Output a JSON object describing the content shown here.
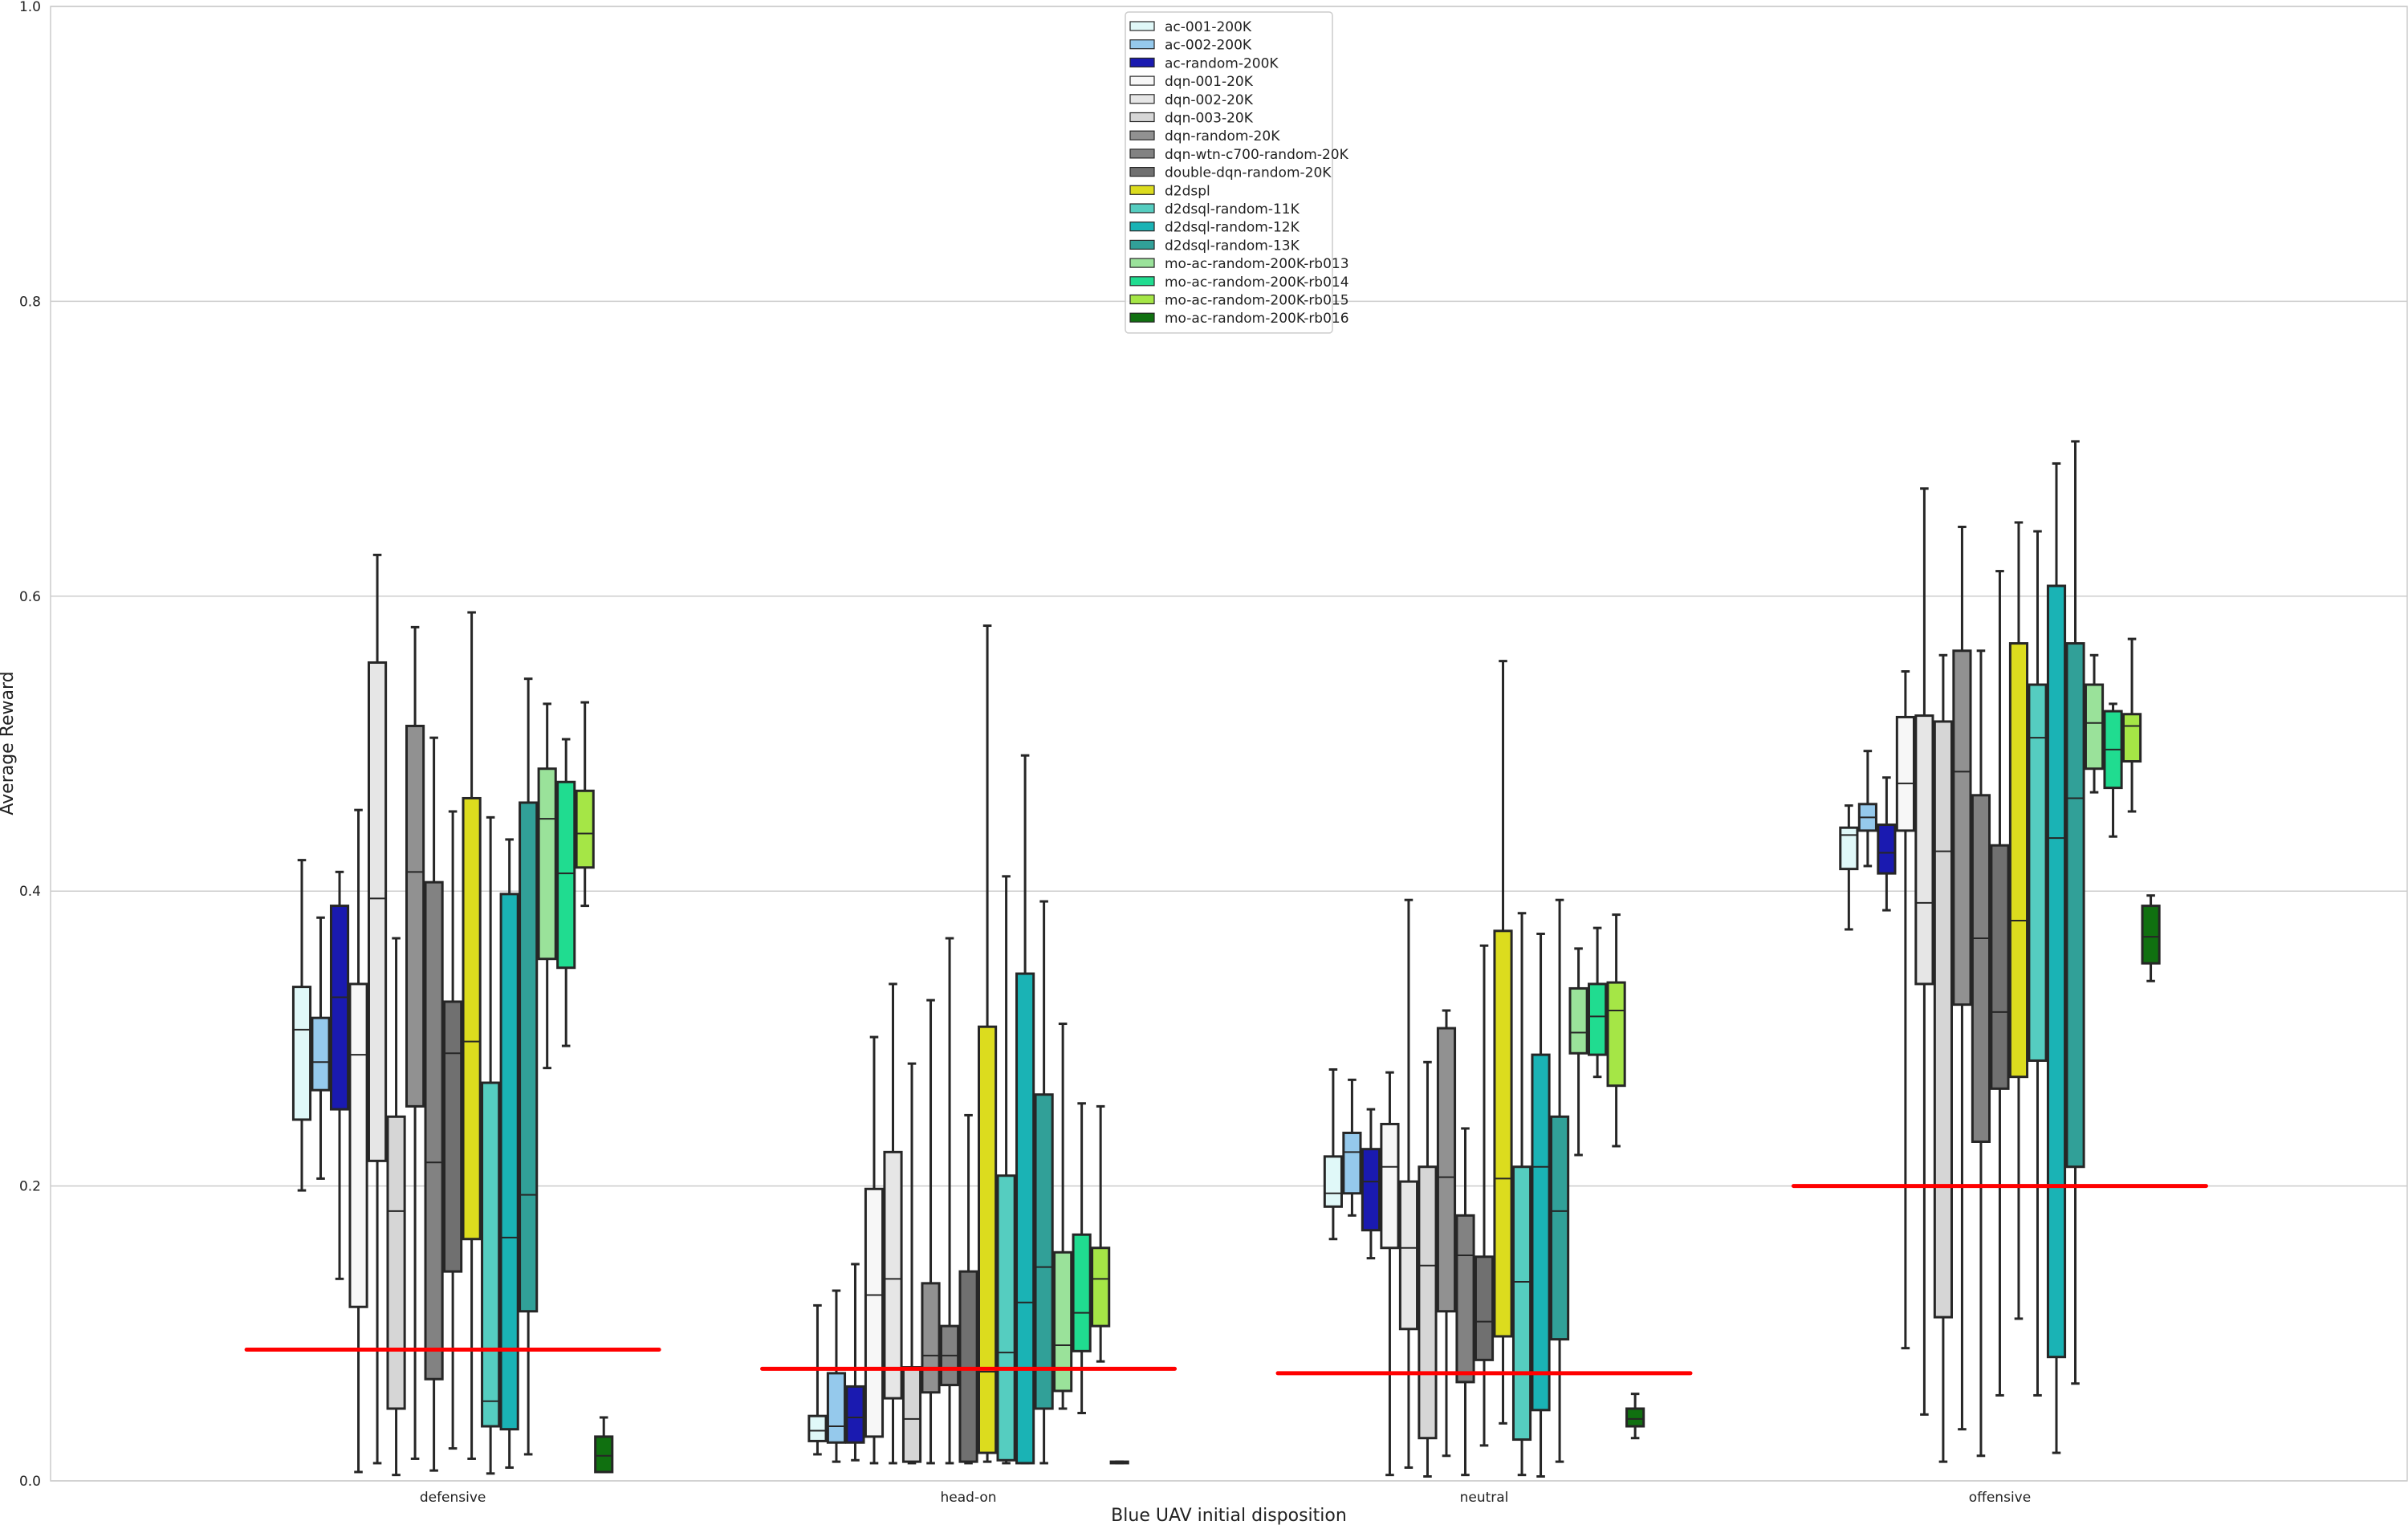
{
  "chart_data": {
    "type": "box",
    "title": "",
    "xlabel": "Blue UAV initial disposition",
    "ylabel": "Average Reward",
    "ylim": [
      0.0,
      1.0
    ],
    "yticks": [
      "0.0",
      "0.2",
      "0.4",
      "0.6",
      "0.8",
      "1.0"
    ],
    "categories": [
      "defensive",
      "head-on",
      "neutral",
      "offensive"
    ],
    "grid": "horizontal",
    "legend_position": "top-center",
    "box_stat_order": [
      "whisker_low",
      "q1",
      "median",
      "q3",
      "whisker_high"
    ],
    "reference_line": {
      "color": "#ff0000",
      "values": [
        0.089,
        0.076,
        0.073,
        0.2
      ]
    },
    "series": [
      {
        "name": "ac-001-200K",
        "color": "#e0f8f8",
        "boxes": [
          [
            0.197,
            0.245,
            0.306,
            0.335,
            0.421
          ],
          [
            0.018,
            0.027,
            0.034,
            0.044,
            0.119
          ],
          [
            0.164,
            0.186,
            0.195,
            0.22,
            0.279
          ],
          [
            0.374,
            0.415,
            0.438,
            0.443,
            0.458
          ]
        ]
      },
      {
        "name": "ac-002-200K",
        "color": "#95c9ec",
        "boxes": [
          [
            0.205,
            0.265,
            0.284,
            0.314,
            0.382
          ],
          [
            0.013,
            0.026,
            0.037,
            0.073,
            0.129
          ],
          [
            0.18,
            0.195,
            0.223,
            0.236,
            0.272
          ],
          [
            0.417,
            0.441,
            0.45,
            0.459,
            0.495
          ]
        ]
      },
      {
        "name": "ac-random-200K",
        "color": "#1a1ab0",
        "boxes": [
          [
            0.137,
            0.252,
            0.328,
            0.39,
            0.413
          ],
          [
            0.014,
            0.026,
            0.043,
            0.064,
            0.147
          ],
          [
            0.151,
            0.17,
            0.203,
            0.225,
            0.252
          ],
          [
            0.387,
            0.412,
            0.426,
            0.445,
            0.477
          ]
        ]
      },
      {
        "name": "dqn-001-20K",
        "color": "#f7f7f7",
        "boxes": [
          [
            0.006,
            0.118,
            0.289,
            0.337,
            0.455
          ],
          [
            0.012,
            0.03,
            0.126,
            0.198,
            0.301
          ],
          [
            0.004,
            0.158,
            0.213,
            0.242,
            0.277
          ],
          [
            0.09,
            0.441,
            0.473,
            0.518,
            0.549
          ]
        ]
      },
      {
        "name": "dqn-002-20K",
        "color": "#e6e6e6",
        "boxes": [
          [
            0.012,
            0.217,
            0.395,
            0.555,
            0.628
          ],
          [
            0.012,
            0.056,
            0.137,
            0.223,
            0.337
          ],
          [
            0.009,
            0.103,
            0.158,
            0.203,
            0.394
          ],
          [
            0.045,
            0.337,
            0.392,
            0.519,
            0.673
          ]
        ]
      },
      {
        "name": "dqn-003-20K",
        "color": "#d6d6d6",
        "boxes": [
          [
            0.004,
            0.049,
            0.183,
            0.247,
            0.368
          ],
          [
            0.012,
            0.013,
            0.042,
            0.077,
            0.283
          ],
          [
            0.003,
            0.029,
            0.146,
            0.213,
            0.284
          ],
          [
            0.013,
            0.111,
            0.427,
            0.515,
            0.56
          ]
        ]
      },
      {
        "name": "dqn-random-20K",
        "color": "#919191",
        "boxes": [
          [
            0.015,
            0.254,
            0.413,
            0.512,
            0.579
          ],
          [
            0.012,
            0.06,
            0.085,
            0.134,
            0.326
          ],
          [
            0.017,
            0.115,
            0.206,
            0.307,
            0.319
          ],
          [
            0.035,
            0.323,
            0.481,
            0.563,
            0.647
          ]
        ]
      },
      {
        "name": "dqn-wtn-c700-random-20K",
        "color": "#828282",
        "boxes": [
          [
            0.007,
            0.069,
            0.216,
            0.406,
            0.504
          ],
          [
            0.012,
            0.065,
            0.085,
            0.105,
            0.368
          ],
          [
            0.004,
            0.067,
            0.153,
            0.18,
            0.239
          ],
          [
            0.017,
            0.23,
            0.368,
            0.465,
            0.563
          ]
        ]
      },
      {
        "name": "double-dqn-random-20K",
        "color": "#707070",
        "boxes": [
          [
            0.022,
            0.142,
            0.29,
            0.325,
            0.454
          ],
          [
            0.012,
            0.013,
            0.013,
            0.142,
            0.248
          ],
          [
            0.024,
            0.082,
            0.108,
            0.152,
            0.363
          ],
          [
            0.058,
            0.266,
            0.318,
            0.431,
            0.617
          ]
        ]
      },
      {
        "name": "d2dspl",
        "color": "#dcdc1e",
        "boxes": [
          [
            0.015,
            0.164,
            0.298,
            0.463,
            0.589
          ],
          [
            0.013,
            0.019,
            0.074,
            0.308,
            0.58
          ],
          [
            0.039,
            0.098,
            0.205,
            0.373,
            0.556
          ],
          [
            0.11,
            0.274,
            0.38,
            0.568,
            0.65
          ]
        ]
      },
      {
        "name": "d2dsql-random-11K",
        "color": "#55cdc0",
        "boxes": [
          [
            0.005,
            0.037,
            0.054,
            0.27,
            0.45
          ],
          [
            0.012,
            0.014,
            0.087,
            0.207,
            0.41
          ],
          [
            0.004,
            0.028,
            0.135,
            0.213,
            0.385
          ],
          [
            0.058,
            0.285,
            0.504,
            0.54,
            0.644
          ]
        ]
      },
      {
        "name": "d2dsql-random-12K",
        "color": "#1ab3b5",
        "boxes": [
          [
            0.009,
            0.035,
            0.165,
            0.398,
            0.435
          ],
          [
            0.012,
            0.012,
            0.121,
            0.344,
            0.492
          ],
          [
            0.003,
            0.048,
            0.213,
            0.289,
            0.371
          ],
          [
            0.019,
            0.084,
            0.436,
            0.607,
            0.69
          ]
        ]
      },
      {
        "name": "d2dsql-random-13K",
        "color": "#31a098",
        "boxes": [
          [
            0.018,
            0.115,
            0.194,
            0.46,
            0.544
          ],
          [
            0.012,
            0.049,
            0.145,
            0.262,
            0.393
          ],
          [
            0.013,
            0.096,
            0.183,
            0.247,
            0.394
          ],
          [
            0.066,
            0.213,
            0.463,
            0.568,
            0.705
          ]
        ]
      },
      {
        "name": "mo-ac-random-200K-rb013",
        "color": "#9ae29a",
        "boxes": [
          [
            0.28,
            0.354,
            0.449,
            0.483,
            0.527
          ],
          [
            0.049,
            0.061,
            0.092,
            0.155,
            0.31
          ],
          [
            0.221,
            0.29,
            0.304,
            0.334,
            0.361
          ],
          [
            0.467,
            0.483,
            0.514,
            0.54,
            0.56
          ]
        ]
      },
      {
        "name": "mo-ac-random-200K-rb014",
        "color": "#20dc90",
        "boxes": [
          [
            0.295,
            0.348,
            0.412,
            0.474,
            0.503
          ],
          [
            0.046,
            0.088,
            0.114,
            0.167,
            0.256
          ],
          [
            0.274,
            0.289,
            0.315,
            0.337,
            0.375
          ],
          [
            0.437,
            0.47,
            0.496,
            0.522,
            0.527
          ]
        ]
      },
      {
        "name": "mo-ac-random-200K-rb015",
        "color": "#a5e646",
        "boxes": [
          [
            0.39,
            0.416,
            0.439,
            0.468,
            0.528
          ],
          [
            0.081,
            0.105,
            0.137,
            0.158,
            0.254
          ],
          [
            0.227,
            0.268,
            0.319,
            0.338,
            0.384
          ],
          [
            0.454,
            0.488,
            0.512,
            0.52,
            0.571
          ]
        ]
      },
      {
        "name": "mo-ac-random-200K-rb016",
        "color": "#107010",
        "boxes": [
          [
            0.006,
            0.006,
            0.017,
            0.03,
            0.043
          ],
          [
            0.012,
            0.012,
            0.0126,
            0.013,
            0.013
          ],
          [
            0.029,
            0.037,
            0.042,
            0.049,
            0.059
          ],
          [
            0.339,
            0.351,
            0.369,
            0.39,
            0.397
          ]
        ]
      }
    ]
  }
}
